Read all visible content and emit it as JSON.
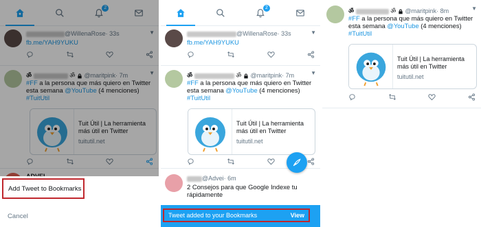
{
  "panel1": {
    "nav": {
      "badge": "2"
    },
    "tweet1": {
      "handle": "@WillenaRose",
      "time": "· 33s",
      "link": "fb.me/YAH9YUKU"
    },
    "tweet2": {
      "handle": "@maritpink",
      "time": "· 7m",
      "hashtag1": "#FF",
      "text1": " a la persona que más quiero en Twitter esta semana ",
      "mention": "@YouTube",
      "text2": " (4 menciones)",
      "hashtag2": "#TuitUtil",
      "card_title": "Tuit Útil | La herramienta más útil en Twitter",
      "card_url": "tuitutil.net"
    },
    "tweet3": {
      "handle": "ADVEI"
    },
    "sheet": {
      "option_label": "Add Tweet to Bookmarks",
      "cancel_label": "Cancel"
    }
  },
  "panel2": {
    "nav": {
      "badge": "2"
    },
    "tweet1": {
      "handle": "@WillenaRose",
      "time": "· 33s",
      "link": "fb.me/YAH9YUKU"
    },
    "tweet2": {
      "handle": "@maritpink",
      "time": "· 7m",
      "hashtag1": "#FF",
      "text1": " a la persona que más quiero en Twitter esta semana ",
      "mention": "@YouTube",
      "text2": " (4 menciones)",
      "hashtag2": "#TuitUtil",
      "card_title": "Tuit Útil | La herramienta más útil en Twitter",
      "card_url": "tuitutil.net"
    },
    "tweet3": {
      "handle": "@Advei",
      "time": "· 6m",
      "text": "2 Consejos para que Google Indexe tu",
      "text_cont": "rápidamente"
    },
    "snackbar": {
      "message": "Tweet added to your Bookmarks",
      "action": "View"
    }
  },
  "panel3": {
    "tweet": {
      "handle": "@maritpink",
      "time": "· 8m",
      "hashtag1": "#FF",
      "text1": " a la persona que más quiero en Twitter esta semana ",
      "mention": "@YouTube",
      "text2": " (4 menciones)",
      "hashtag2": "#TuitUtil",
      "card_title": "Tuit Útil | La herramienta más útil en Twitter",
      "card_url": "tuitutil.net"
    }
  },
  "colors": {
    "accent": "#1da1f2",
    "highlight_border": "#c0272d",
    "link": "#1b95e0",
    "muted": "#657786"
  },
  "icons": [
    "home-icon",
    "search-icon",
    "bell-icon",
    "mail-icon",
    "reply-icon",
    "retweet-icon",
    "like-icon",
    "share-icon",
    "chevron-down-icon",
    "compose-icon",
    "lock-icon"
  ]
}
